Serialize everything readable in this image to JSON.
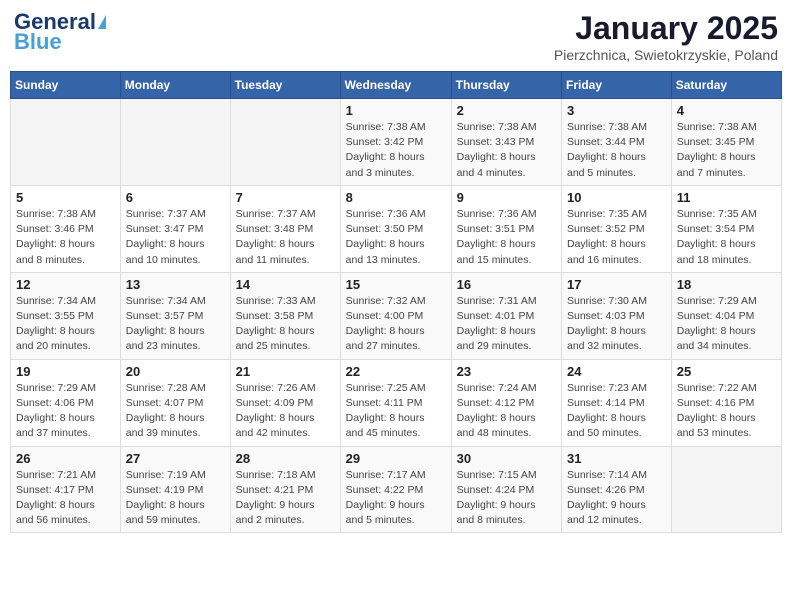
{
  "header": {
    "logo_line1": "General",
    "logo_line2": "Blue",
    "month": "January 2025",
    "location": "Pierzchnica, Swietokrzyskie, Poland"
  },
  "weekdays": [
    "Sunday",
    "Monday",
    "Tuesday",
    "Wednesday",
    "Thursday",
    "Friday",
    "Saturday"
  ],
  "weeks": [
    [
      {
        "day": "",
        "info": ""
      },
      {
        "day": "",
        "info": ""
      },
      {
        "day": "",
        "info": ""
      },
      {
        "day": "1",
        "info": "Sunrise: 7:38 AM\nSunset: 3:42 PM\nDaylight: 8 hours\nand 3 minutes."
      },
      {
        "day": "2",
        "info": "Sunrise: 7:38 AM\nSunset: 3:43 PM\nDaylight: 8 hours\nand 4 minutes."
      },
      {
        "day": "3",
        "info": "Sunrise: 7:38 AM\nSunset: 3:44 PM\nDaylight: 8 hours\nand 5 minutes."
      },
      {
        "day": "4",
        "info": "Sunrise: 7:38 AM\nSunset: 3:45 PM\nDaylight: 8 hours\nand 7 minutes."
      }
    ],
    [
      {
        "day": "5",
        "info": "Sunrise: 7:38 AM\nSunset: 3:46 PM\nDaylight: 8 hours\nand 8 minutes."
      },
      {
        "day": "6",
        "info": "Sunrise: 7:37 AM\nSunset: 3:47 PM\nDaylight: 8 hours\nand 10 minutes."
      },
      {
        "day": "7",
        "info": "Sunrise: 7:37 AM\nSunset: 3:48 PM\nDaylight: 8 hours\nand 11 minutes."
      },
      {
        "day": "8",
        "info": "Sunrise: 7:36 AM\nSunset: 3:50 PM\nDaylight: 8 hours\nand 13 minutes."
      },
      {
        "day": "9",
        "info": "Sunrise: 7:36 AM\nSunset: 3:51 PM\nDaylight: 8 hours\nand 15 minutes."
      },
      {
        "day": "10",
        "info": "Sunrise: 7:35 AM\nSunset: 3:52 PM\nDaylight: 8 hours\nand 16 minutes."
      },
      {
        "day": "11",
        "info": "Sunrise: 7:35 AM\nSunset: 3:54 PM\nDaylight: 8 hours\nand 18 minutes."
      }
    ],
    [
      {
        "day": "12",
        "info": "Sunrise: 7:34 AM\nSunset: 3:55 PM\nDaylight: 8 hours\nand 20 minutes."
      },
      {
        "day": "13",
        "info": "Sunrise: 7:34 AM\nSunset: 3:57 PM\nDaylight: 8 hours\nand 23 minutes."
      },
      {
        "day": "14",
        "info": "Sunrise: 7:33 AM\nSunset: 3:58 PM\nDaylight: 8 hours\nand 25 minutes."
      },
      {
        "day": "15",
        "info": "Sunrise: 7:32 AM\nSunset: 4:00 PM\nDaylight: 8 hours\nand 27 minutes."
      },
      {
        "day": "16",
        "info": "Sunrise: 7:31 AM\nSunset: 4:01 PM\nDaylight: 8 hours\nand 29 minutes."
      },
      {
        "day": "17",
        "info": "Sunrise: 7:30 AM\nSunset: 4:03 PM\nDaylight: 8 hours\nand 32 minutes."
      },
      {
        "day": "18",
        "info": "Sunrise: 7:29 AM\nSunset: 4:04 PM\nDaylight: 8 hours\nand 34 minutes."
      }
    ],
    [
      {
        "day": "19",
        "info": "Sunrise: 7:29 AM\nSunset: 4:06 PM\nDaylight: 8 hours\nand 37 minutes."
      },
      {
        "day": "20",
        "info": "Sunrise: 7:28 AM\nSunset: 4:07 PM\nDaylight: 8 hours\nand 39 minutes."
      },
      {
        "day": "21",
        "info": "Sunrise: 7:26 AM\nSunset: 4:09 PM\nDaylight: 8 hours\nand 42 minutes."
      },
      {
        "day": "22",
        "info": "Sunrise: 7:25 AM\nSunset: 4:11 PM\nDaylight: 8 hours\nand 45 minutes."
      },
      {
        "day": "23",
        "info": "Sunrise: 7:24 AM\nSunset: 4:12 PM\nDaylight: 8 hours\nand 48 minutes."
      },
      {
        "day": "24",
        "info": "Sunrise: 7:23 AM\nSunset: 4:14 PM\nDaylight: 8 hours\nand 50 minutes."
      },
      {
        "day": "25",
        "info": "Sunrise: 7:22 AM\nSunset: 4:16 PM\nDaylight: 8 hours\nand 53 minutes."
      }
    ],
    [
      {
        "day": "26",
        "info": "Sunrise: 7:21 AM\nSunset: 4:17 PM\nDaylight: 8 hours\nand 56 minutes."
      },
      {
        "day": "27",
        "info": "Sunrise: 7:19 AM\nSunset: 4:19 PM\nDaylight: 8 hours\nand 59 minutes."
      },
      {
        "day": "28",
        "info": "Sunrise: 7:18 AM\nSunset: 4:21 PM\nDaylight: 9 hours\nand 2 minutes."
      },
      {
        "day": "29",
        "info": "Sunrise: 7:17 AM\nSunset: 4:22 PM\nDaylight: 9 hours\nand 5 minutes."
      },
      {
        "day": "30",
        "info": "Sunrise: 7:15 AM\nSunset: 4:24 PM\nDaylight: 9 hours\nand 8 minutes."
      },
      {
        "day": "31",
        "info": "Sunrise: 7:14 AM\nSunset: 4:26 PM\nDaylight: 9 hours\nand 12 minutes."
      },
      {
        "day": "",
        "info": ""
      }
    ]
  ]
}
